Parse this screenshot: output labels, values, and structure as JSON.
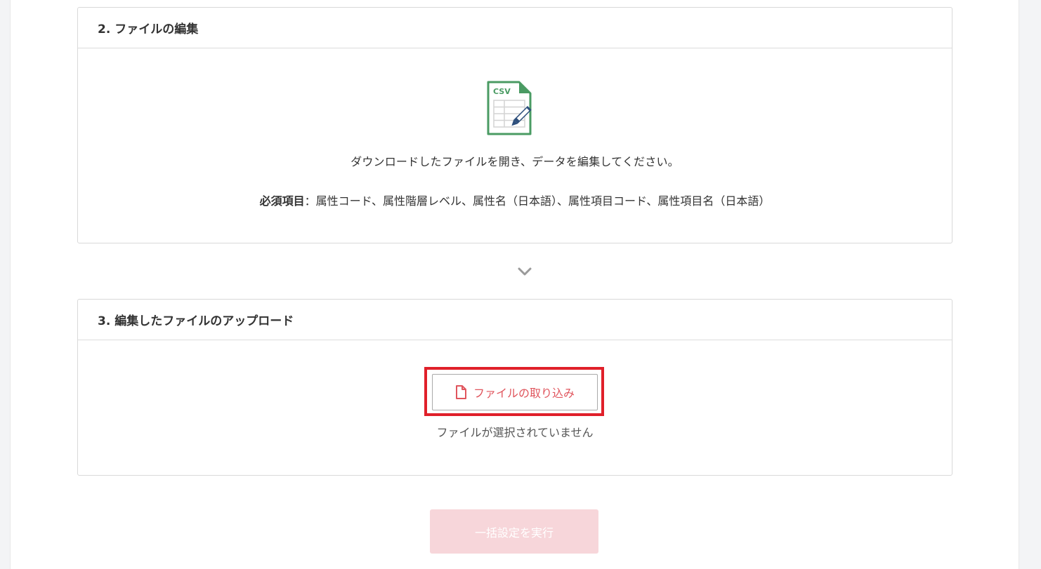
{
  "step2": {
    "title": "2. ファイルの編集",
    "icon": "csv-edit-icon",
    "icon_text": "CSV",
    "instruction": "ダウンロードしたファイルを開き、データを編集してください。",
    "required_label": "必須項目",
    "required_separator": "：",
    "required_fields": "属性コード、属性階層レベル、属性名（日本語）、属性項目コード、属性項目名（日本語）"
  },
  "divider": {
    "icon": "chevron-down-icon"
  },
  "step3": {
    "title": "3. 編集したファイルのアップロード",
    "import_button_label": "ファイルの取り込み",
    "import_button_icon": "file-icon",
    "no_file_text": "ファイルが選択されていません"
  },
  "execute_button_label": "一括設定を実行",
  "colors": {
    "accent": "#e0555d",
    "highlight": "#e0202a",
    "csv_green": "#4a9b63",
    "pen_blue": "#2d4f7c",
    "disabled_button": "#f7d6da"
  }
}
